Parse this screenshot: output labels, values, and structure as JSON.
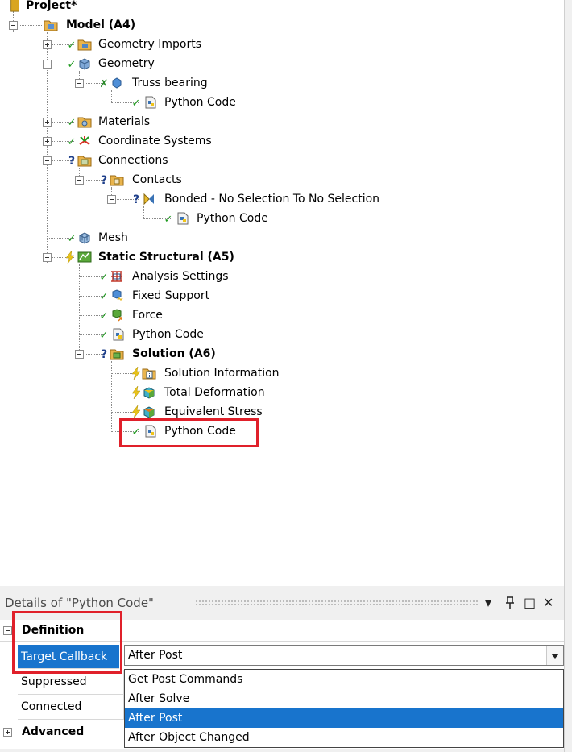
{
  "tree": {
    "root": "Project*",
    "model": "Model (A4)",
    "geometry_imports": "Geometry Imports",
    "geometry": "Geometry",
    "truss_bearing": "Truss bearing",
    "python_code_1": "Python Code",
    "materials": "Materials",
    "coordinate_systems": "Coordinate Systems",
    "connections": "Connections",
    "contacts": "Contacts",
    "bonded": "Bonded - No Selection To No Selection",
    "python_code_2": "Python Code",
    "mesh": "Mesh",
    "static_structural": "Static Structural (A5)",
    "analysis_settings": "Analysis Settings",
    "fixed_support": "Fixed Support",
    "force": "Force",
    "python_code_3": "Python Code",
    "solution": "Solution (A6)",
    "solution_information": "Solution Information",
    "total_deformation": "Total Deformation",
    "equivalent_stress": "Equivalent Stress",
    "python_code_4": "Python Code"
  },
  "details": {
    "title": "Details of \"Python Code\"",
    "pin": "̧",
    "restore": "□",
    "close": "✕",
    "dropdown_arrow": "▾",
    "section_definition": "Definition",
    "section_advanced": "Advanced",
    "target_callback_label": "Target Callback",
    "target_callback_value": "After Post",
    "suppressed_label": "Suppressed",
    "connected_label": "Connected",
    "options": [
      "Get Post Commands",
      "After Solve",
      "After Post",
      "After Object Changed"
    ],
    "selected_option": "After Post"
  },
  "colors": {
    "selection": "#1874cd",
    "highlight_box": "#e0202a",
    "check": "#1f9a1f",
    "bolt": "#e8c21a"
  }
}
